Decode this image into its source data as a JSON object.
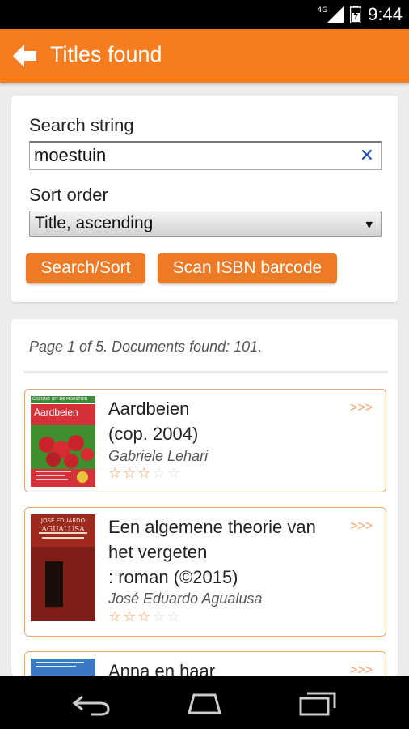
{
  "status_bar": {
    "network": "4G",
    "time": "9:44"
  },
  "action_bar": {
    "title": "Titles found",
    "back_icon": "back-arrow-icon"
  },
  "search": {
    "search_label": "Search string",
    "search_value": "moestuin",
    "sort_label": "Sort order",
    "sort_value": "Title, ascending",
    "search_button": "Search/Sort",
    "scan_button": "Scan ISBN barcode"
  },
  "results": {
    "page_info": "Page 1 of 5. Documents found: 101.",
    "more_label": ">>>",
    "items": [
      {
        "title_line1": "Aardbeien",
        "title_line2": "(cop. 2004)",
        "title_line3": "",
        "author": "Gabriele Lehari",
        "rating": 2.5,
        "cover_text": "Aardbeien",
        "cover_top_text": "GEZOND UIT DE MOESTUIN"
      },
      {
        "title_line1": "Een algemene theorie van",
        "title_line2": "het vergeten",
        "title_line3": ": roman (©2015)",
        "author": "José Eduardo Agualusa",
        "rating": 2.5,
        "cover_text": "AGUALUSA",
        "cover_top_text": "JOSÉ EDUARDO"
      },
      {
        "title_line1": "Anna en haar",
        "author": "",
        "cover_text": ""
      }
    ]
  },
  "nav_bar": {
    "back": "back-nav-icon",
    "home": "home-nav-icon",
    "recents": "recents-nav-icon"
  },
  "colors": {
    "accent": "#f57c1f",
    "button": "#ef7a26",
    "item_border": "#f5a467"
  }
}
